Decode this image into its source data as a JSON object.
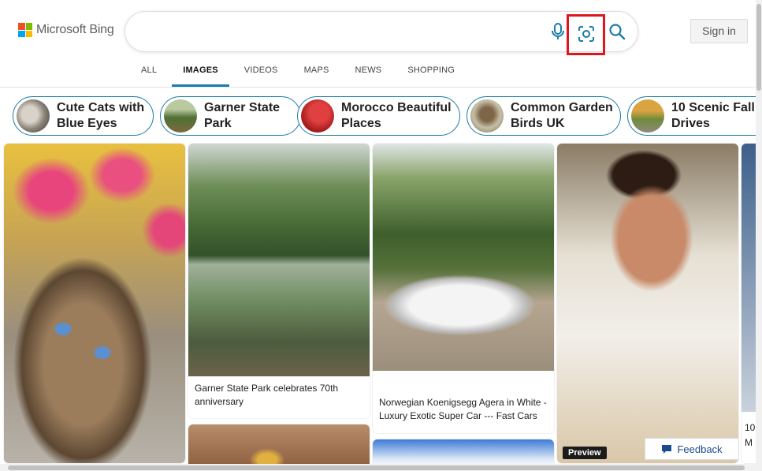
{
  "brand": {
    "name": "Microsoft Bing"
  },
  "search": {
    "value": "",
    "placeholder": ""
  },
  "header": {
    "sign_in": "Sign in"
  },
  "tabs": [
    {
      "label": "ALL",
      "active": false
    },
    {
      "label": "IMAGES",
      "active": true
    },
    {
      "label": "VIDEOS",
      "active": false
    },
    {
      "label": "MAPS",
      "active": false
    },
    {
      "label": "NEWS",
      "active": false
    },
    {
      "label": "SHOPPING",
      "active": false
    }
  ],
  "related": [
    {
      "label": "Cute Cats with\nBlue Eyes"
    },
    {
      "label": "Garner State\nPark"
    },
    {
      "label": "Morocco Beautiful\nPlaces"
    },
    {
      "label": "Common Garden\nBirds UK"
    },
    {
      "label": "10 Scenic Fall\nDrives"
    }
  ],
  "results": [
    {
      "caption": ""
    },
    {
      "caption": "Garner State Park celebrates 70th\nanniversary"
    },
    {
      "caption": "Norwegian Koenigsegg Agera in White -\nLuxury Exotic Super Car --- Fast Cars"
    },
    {
      "caption": ""
    }
  ],
  "badges": {
    "preview": "Preview",
    "partial": "10\nM"
  },
  "feedback": {
    "label": "Feedback"
  },
  "colors": {
    "accent": "#1a7ca7",
    "highlight": "#e0161e"
  },
  "icons": [
    "microphone-icon",
    "visual-search-icon",
    "search-icon",
    "feedback-icon"
  ]
}
